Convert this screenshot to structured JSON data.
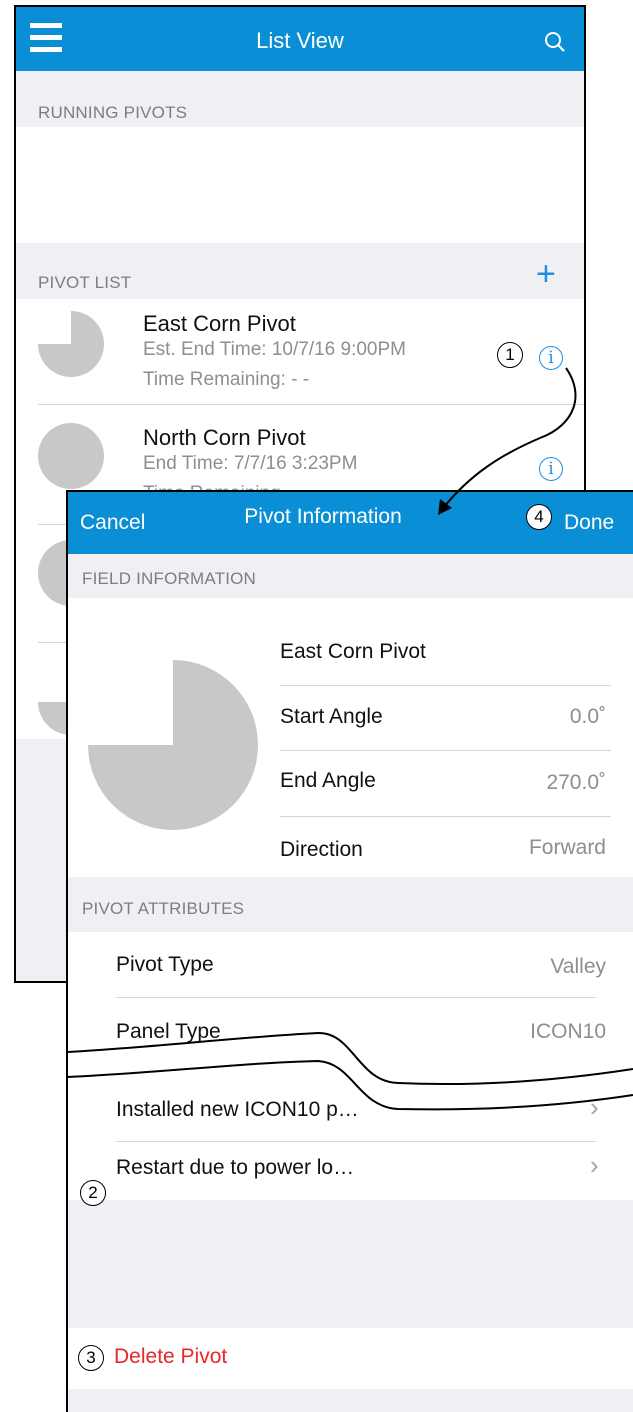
{
  "list_view": {
    "title": "List View",
    "section_running": "RUNNING PIVOTS",
    "section_pivot_list": "PIVOT LIST",
    "add_symbol": "+",
    "items": [
      {
        "name": "East Corn Pivot",
        "line1": "Est. End Time: 10/7/16  9:00PM",
        "line2": "Time Remaining: - -"
      },
      {
        "name": "North Corn Pivot",
        "line1": "End Time: 7/7/16  3:23PM",
        "line2": "Time Remaining"
      }
    ]
  },
  "pivot_info": {
    "cancel": "Cancel",
    "title": "Pivot Information",
    "done": "Done",
    "field_header": "FIELD INFORMATION",
    "pivot_name": "East Corn Pivot",
    "fields": [
      {
        "label": "Start Angle",
        "value": "0.0˚"
      },
      {
        "label": "End Angle",
        "value": "270.0˚"
      },
      {
        "label": "Direction",
        "value": "Forward"
      }
    ],
    "attributes_header": "PIVOT ATTRIBUTES",
    "attributes": [
      {
        "label": "Pivot Type",
        "value": "Valley"
      },
      {
        "label": "Panel Type",
        "value": "ICON10"
      }
    ],
    "notes": [
      {
        "label": "Installed new ICON10 p…"
      },
      {
        "label": "Restart due to power lo…"
      }
    ],
    "delete": "Delete Pivot",
    "chevron": "›"
  },
  "callouts": [
    "1",
    "2",
    "3",
    "4"
  ],
  "colors": {
    "nav": "#0a8fd6",
    "accent": "#1e8fe0",
    "destructive": "#e8262b",
    "pie": "#c8c8c8"
  }
}
